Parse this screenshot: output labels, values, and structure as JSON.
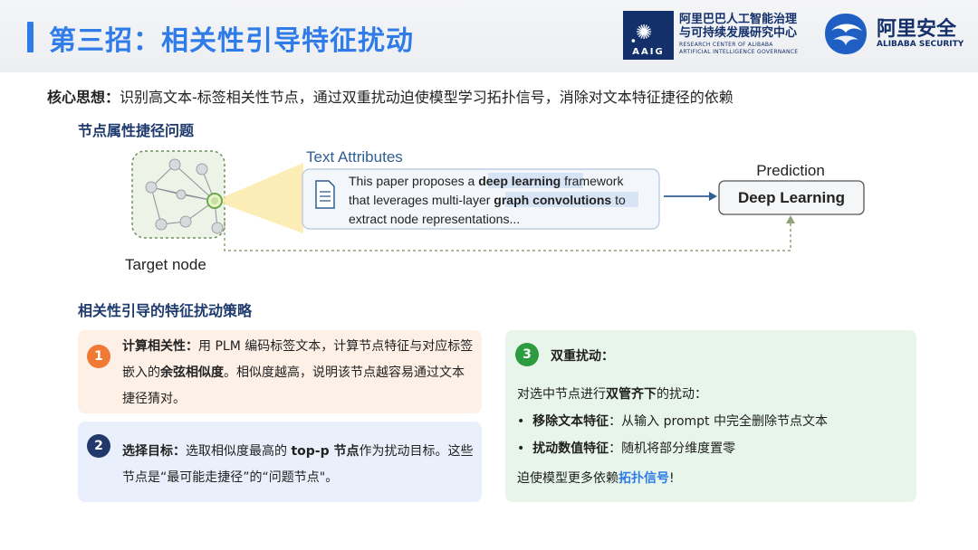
{
  "header": {
    "title": "第三招：相关性引导特征扰动",
    "aaig": {
      "mark_text": "AAIG",
      "cn_line1": "阿里巴巴人工智能治理",
      "cn_line2": "与可持续发展研究中心",
      "en_line1": "RESEARCH CENTER OF ALIBABA",
      "en_line2": "ARTIFICIAL INTELLIGENCE GOVERNANCE"
    },
    "alibaba_security": {
      "cn": "阿里安全",
      "en": "ALIBABA SECURITY"
    }
  },
  "core": {
    "label": "核心思想：",
    "text": "识别高文本-标签相关性节点，通过双重扰动迫使模型学习拓扑信号，消除对文本特征捷径的依赖"
  },
  "section1": {
    "title": "节点属性捷径问题"
  },
  "diagram": {
    "text_attributes_label": "Text Attributes",
    "sentence_line1_a": "This paper proposes a ",
    "sentence_line1_hl": "deep learning",
    "sentence_line1_b": " framework",
    "sentence_line2_a": "that leverages multi-layer ",
    "sentence_line2_hl": "graph convolutions",
    "sentence_line2_b": " to",
    "sentence_line3": "extract node representations...",
    "prediction_label": "Prediction",
    "prediction_value": "Deep Learning",
    "target_node_label": "Target node"
  },
  "section2": {
    "title": "相关性引导的特征扰动策略"
  },
  "cards": {
    "c1": {
      "number": "1",
      "bold1": "计算相关性：",
      "text1": "用 PLM 编码标签文本，计算节点特征与对应标签嵌入的",
      "bold2": "余弦相似度",
      "text2": "。相似度越高，说明该节点越容易通过文本捷径猜对。"
    },
    "c2": {
      "number": "2",
      "bold1": "选择目标：",
      "text1": "选取相似度最高的 ",
      "bold2": "top-p 节点",
      "text2": "作为扰动目标。这些节点是“最可能走捷径”的“问题节点\"。"
    },
    "c3": {
      "number": "3",
      "heading": "双重扰动：",
      "intro_a": "对选中节点进行",
      "intro_b": "双管齐下",
      "intro_c": "的扰动：",
      "bullet1_bold": "移除文本特征",
      "bullet1_text": "：从输入 prompt 中完全删除节点文本",
      "bullet2_bold": "扰动数值特征",
      "bullet2_text": "：随机将部分维度置零",
      "ending_a": "迫使模型更多依赖",
      "ending_b": "拓扑信号",
      "ending_c": "!"
    }
  },
  "colors": {
    "title_blue": "#2f7ce8",
    "navy": "#14306b",
    "orange": "#f07a35",
    "green": "#2d9b3f",
    "highlight": "#d6e4f5"
  }
}
